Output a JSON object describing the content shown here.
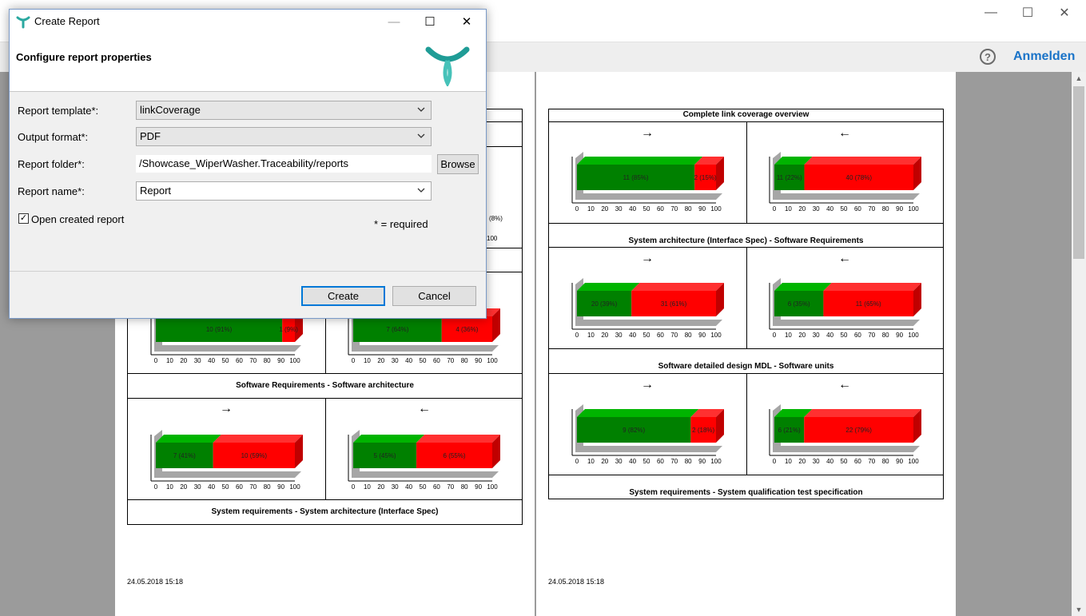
{
  "app": {
    "window_controls": {
      "minimize": "—",
      "maximize": "☐",
      "close": "✕"
    },
    "help_label": "?",
    "login_label": "Anmelden"
  },
  "dialog": {
    "title": "Create Report",
    "heading": "Configure report properties",
    "controls": {
      "minimize": "—",
      "maximize": "☐",
      "close": "✕"
    },
    "fields": {
      "template_label": "Report template*:",
      "template_value": "linkCoverage",
      "format_label": "Output format*:",
      "format_value": "PDF",
      "folder_label": "Report folder*:",
      "folder_value": "/Showcase_WiperWasher.Traceability/reports",
      "browse_label": "Browse",
      "name_label": "Report name*:",
      "name_value": "Report"
    },
    "open_report_label": "Open created report",
    "open_report_checked": true,
    "required_note": "* = required",
    "create_label": "Create",
    "cancel_label": "Cancel"
  },
  "report": {
    "axis_ticks": [
      "0",
      "10",
      "20",
      "30",
      "40",
      "50",
      "60",
      "70",
      "80",
      "90",
      "100"
    ],
    "colors": {
      "covered": "#008000",
      "covered_top": "#00b400",
      "uncovered": "#ff0000",
      "uncovered_side": "#c00000",
      "shadow": "#a6a6a6"
    },
    "right_arrow": "→",
    "left_arrow": "←",
    "left_page": {
      "partial_values": [
        "(8%)",
        "100"
      ],
      "section_titles": [
        "Software Requirements - Software architecture",
        "System requirements - System architecture (Interface Spec)"
      ],
      "timestamp": "24.05.2018 15:18"
    },
    "right_page": {
      "section_titles": [
        "Complete link coverage overview",
        "System architecture (Interface Spec) - Software Requirements",
        "Software detailed design MDL - Software units",
        "System requirements - System qualification test specification"
      ],
      "timestamp": "24.05.2018 15:18"
    }
  },
  "chart_data": [
    {
      "type": "bar",
      "title": "",
      "direction": "→",
      "series": [
        {
          "name": "covered",
          "values": [
            10
          ]
        },
        {
          "name": "uncovered",
          "values": [
            1
          ]
        }
      ],
      "labels": [
        "10 (91%)",
        "1 (9%)"
      ],
      "xlim": [
        0,
        100
      ]
    },
    {
      "type": "bar",
      "title": "",
      "direction": "←",
      "series": [
        {
          "name": "covered",
          "values": [
            7
          ]
        },
        {
          "name": "uncovered",
          "values": [
            4
          ]
        }
      ],
      "labels": [
        "7 (64%)",
        "4 (36%)"
      ],
      "xlim": [
        0,
        100
      ]
    },
    {
      "type": "bar",
      "title": "Software Requirements - Software architecture",
      "direction": "→",
      "series": [
        {
          "name": "covered",
          "values": [
            7
          ]
        },
        {
          "name": "uncovered",
          "values": [
            10
          ]
        }
      ],
      "labels": [
        "7 (41%)",
        "10 (59%)"
      ],
      "xlim": [
        0,
        100
      ]
    },
    {
      "type": "bar",
      "title": "Software Requirements - Software architecture",
      "direction": "←",
      "series": [
        {
          "name": "covered",
          "values": [
            5
          ]
        },
        {
          "name": "uncovered",
          "values": [
            6
          ]
        }
      ],
      "labels": [
        "5 (45%)",
        "6 (55%)"
      ],
      "xlim": [
        0,
        100
      ]
    },
    {
      "type": "bar",
      "title": "Complete link coverage overview",
      "direction": "→",
      "series": [
        {
          "name": "covered",
          "values": [
            11
          ]
        },
        {
          "name": "uncovered",
          "values": [
            2
          ]
        }
      ],
      "labels": [
        "11 (85%)",
        "2 (15%)"
      ],
      "xlim": [
        0,
        100
      ]
    },
    {
      "type": "bar",
      "title": "Complete link coverage overview",
      "direction": "←",
      "series": [
        {
          "name": "covered",
          "values": [
            11
          ]
        },
        {
          "name": "uncovered",
          "values": [
            40
          ]
        }
      ],
      "labels": [
        "11 (22%)",
        "40 (78%)"
      ],
      "xlim": [
        0,
        100
      ]
    },
    {
      "type": "bar",
      "title": "System architecture (Interface Spec) - Software Requirements",
      "direction": "→",
      "series": [
        {
          "name": "covered",
          "values": [
            20
          ]
        },
        {
          "name": "uncovered",
          "values": [
            31
          ]
        }
      ],
      "labels": [
        "20 (39%)",
        "31 (61%)"
      ],
      "xlim": [
        0,
        100
      ]
    },
    {
      "type": "bar",
      "title": "System architecture (Interface Spec) - Software Requirements",
      "direction": "←",
      "series": [
        {
          "name": "covered",
          "values": [
            6
          ]
        },
        {
          "name": "uncovered",
          "values": [
            11
          ]
        }
      ],
      "labels": [
        "6 (35%)",
        "11 (65%)"
      ],
      "xlim": [
        0,
        100
      ]
    },
    {
      "type": "bar",
      "title": "Software detailed design MDL - Software units",
      "direction": "→",
      "series": [
        {
          "name": "covered",
          "values": [
            9
          ]
        },
        {
          "name": "uncovered",
          "values": [
            2
          ]
        }
      ],
      "labels": [
        "9 (82%)",
        "2 (18%)"
      ],
      "xlim": [
        0,
        100
      ]
    },
    {
      "type": "bar",
      "title": "Software detailed design MDL - Software units",
      "direction": "←",
      "series": [
        {
          "name": "covered",
          "values": [
            6
          ]
        },
        {
          "name": "uncovered",
          "values": [
            22
          ]
        }
      ],
      "labels": [
        "6 (21%)",
        "22 (79%)"
      ],
      "xlim": [
        0,
        100
      ]
    }
  ]
}
